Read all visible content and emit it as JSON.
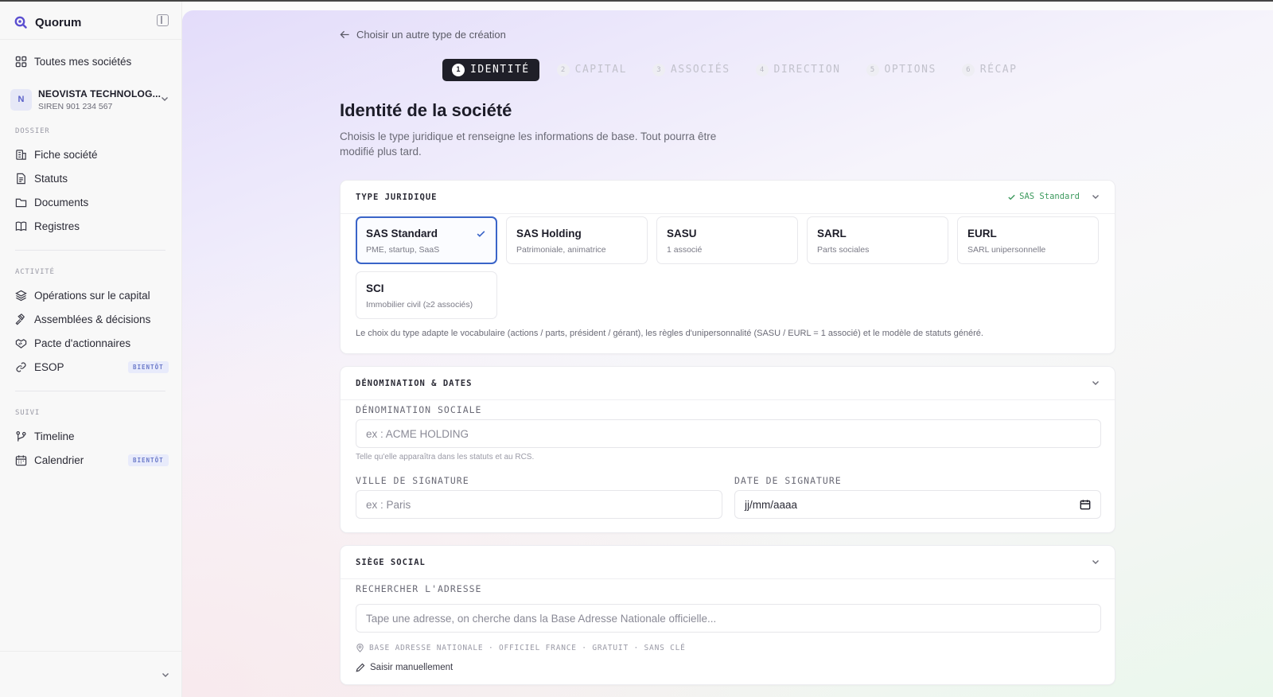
{
  "app": {
    "name": "Quorum"
  },
  "sidebar": {
    "all_companies": "Toutes mes sociétés",
    "company": {
      "initial": "N",
      "name": "NEOVISTA TECHNOLOG...",
      "siren": "SIREN 901 234 567"
    },
    "sections": [
      {
        "label": "DOSSIER",
        "items": [
          {
            "label": "Fiche société",
            "icon": "building-icon"
          },
          {
            "label": "Statuts",
            "icon": "document-icon"
          },
          {
            "label": "Documents",
            "icon": "folder-icon"
          },
          {
            "label": "Registres",
            "icon": "book-icon"
          }
        ]
      },
      {
        "label": "ACTIVITÉ",
        "items": [
          {
            "label": "Opérations sur le capital",
            "icon": "layers-icon"
          },
          {
            "label": "Assemblées & décisions",
            "icon": "gavel-icon"
          },
          {
            "label": "Pacte d'actionnaires",
            "icon": "handshake-icon"
          },
          {
            "label": "ESOP",
            "icon": "link-icon",
            "badge": "BIENTÔT"
          }
        ]
      },
      {
        "label": "SUIVI",
        "items": [
          {
            "label": "Timeline",
            "icon": "branch-icon"
          },
          {
            "label": "Calendrier",
            "icon": "calendar-icon",
            "badge": "BIENTÔT"
          }
        ]
      }
    ]
  },
  "main": {
    "back_link": "Choisir un autre type de création",
    "steps": [
      {
        "num": "1",
        "label": "IDENTITÉ",
        "active": true
      },
      {
        "num": "2",
        "label": "CAPITAL"
      },
      {
        "num": "3",
        "label": "ASSOCIÉS"
      },
      {
        "num": "4",
        "label": "DIRECTION"
      },
      {
        "num": "5",
        "label": "OPTIONS"
      },
      {
        "num": "6",
        "label": "RÉCAP"
      }
    ],
    "title": "Identité de la société",
    "subtitle": "Choisis le type juridique et renseigne les informations de base. Tout pourra être modifié plus tard.",
    "type_card": {
      "title": "TYPE JURIDIQUE",
      "selected": "SAS Standard",
      "options": [
        {
          "name": "SAS Standard",
          "desc": "PME, startup, SaaS",
          "selected": true
        },
        {
          "name": "SAS Holding",
          "desc": "Patrimoniale, animatrice"
        },
        {
          "name": "SASU",
          "desc": "1 associé"
        },
        {
          "name": "SARL",
          "desc": "Parts sociales"
        },
        {
          "name": "EURL",
          "desc": "SARL unipersonnelle"
        },
        {
          "name": "SCI",
          "desc": "Immobilier civil (≥2 associés)"
        }
      ],
      "note": "Le choix du type adapte le vocabulaire (actions / parts, président / gérant), les règles d'unipersonnalité (SASU / EURL = 1 associé) et le modèle de statuts généré."
    },
    "denomination_card": {
      "title": "DÉNOMINATION & DATES",
      "name_label": "DÉNOMINATION SOCIALE",
      "name_placeholder": "ex : ACME HOLDING",
      "name_help": "Telle qu'elle apparaîtra dans les statuts et au RCS.",
      "city_label": "VILLE DE SIGNATURE",
      "city_placeholder": "ex : Paris",
      "date_label": "DATE DE SIGNATURE",
      "date_value": "jj/mm/aaaa"
    },
    "siege_card": {
      "title": "SIÈGE SOCIAL",
      "search_label": "RECHERCHER L'ADRESSE",
      "search_placeholder": "Tape une adresse, on cherche dans la Base Adresse Nationale officielle...",
      "source_line": "BASE ADRESSE NATIONALE · OFFICIEL FRANCE · GRATUIT · SANS CLÉ",
      "manual_link": "Saisir manuellement"
    }
  },
  "colors": {
    "accent": "#3a64c8",
    "success": "#3d9a5e",
    "stepper_active": "#1f1f28",
    "badge": "#6b7ac9"
  }
}
